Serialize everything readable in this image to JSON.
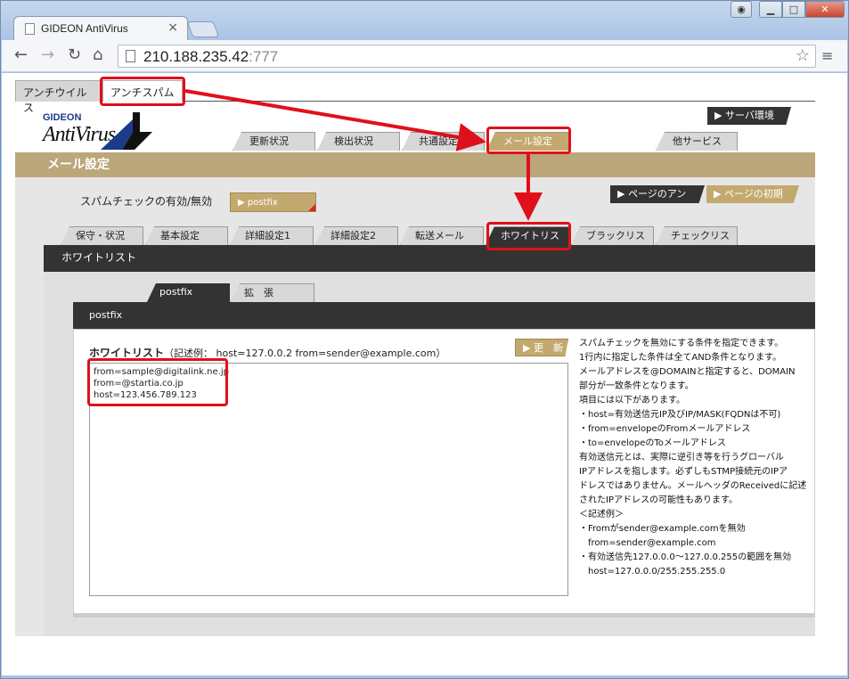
{
  "browser": {
    "tab_title": "GIDEON AntiVirus",
    "tab_close": "×",
    "url_host": "210.188.235.42",
    "url_port": ":777",
    "back": "←",
    "forward": "→",
    "reload": "↻",
    "home": "⌂",
    "star": "☆",
    "menu": "≡",
    "win_min": "▁",
    "win_max": "□",
    "win_close": "✕",
    "win_user": "👤"
  },
  "app_tabs": {
    "antivirus": "アンチウイルス",
    "antispam": "アンチスパム"
  },
  "logo": {
    "small": "GIDEON",
    "big": "AntiVirus"
  },
  "server_env_button": "▶ サーバ環境",
  "main_tabs": [
    "更新状況",
    "検出状況",
    "共通設定",
    "メール設定",
    "他サービス"
  ],
  "section_title": "メール設定",
  "spam_check_label": "スパムチェックの有効/無効",
  "postfix_button": "▶ postfix",
  "undo_button": "▶ ページのアンドゥ",
  "init_button": "▶ ページの初期化",
  "sub_tabs": [
    "保守・状況",
    "基本設定",
    "詳細設定1",
    "詳細設定2",
    "転送メール",
    "ホワイトリスト",
    "ブラックリスト",
    "チェックリスト"
  ],
  "subsection_title": "ホワイトリスト",
  "pf_tabs": [
    "postfix",
    "拡　張"
  ],
  "pf_bar_title": "postfix",
  "whitelist_label": "ホワイトリスト",
  "whitelist_example": "（記述例： host=127.0.0.2  from=sender@example.com）",
  "update_button": "▶ 更　新",
  "whitelist_entries": [
    "from=sample@digitalink.ne.jp",
    "from=@startia.co.jp",
    "host=123.456.789.123"
  ],
  "help_lines": [
    "スパムチェックを無効にする条件を指定できます。",
    "1行内に指定した条件は全てAND条件となります。",
    "メールアドレスを@DOMAINと指定すると、DOMAIN",
    "部分が一致条件となります。",
    "項目には以下があります。",
    "・host=有効送信元IP及びIP/MASK(FQDNは不可)",
    "・from=envelopeのFromメールアドレス",
    "・to=envelopeのToメールアドレス",
    "有効送信元とは、実際に逆引き等を行うグローバル",
    "IPアドレスを指します。必ずしもSTMP接続元のIPア",
    "ドレスではありません。メールヘッダのReceivedに記述",
    "されたIPアドレスの可能性もあります。",
    "＜記述例＞",
    "・Fromがsender@example.comを無効",
    "　from=sender@example.com",
    "・有効送信先127.0.0.0～127.0.0.255の範囲を無効",
    "　host=127.0.0.0/255.255.255.0"
  ],
  "colors": {
    "accent_gold": "#c4a96e",
    "dark": "#333333",
    "highlight": "#e0101a"
  }
}
